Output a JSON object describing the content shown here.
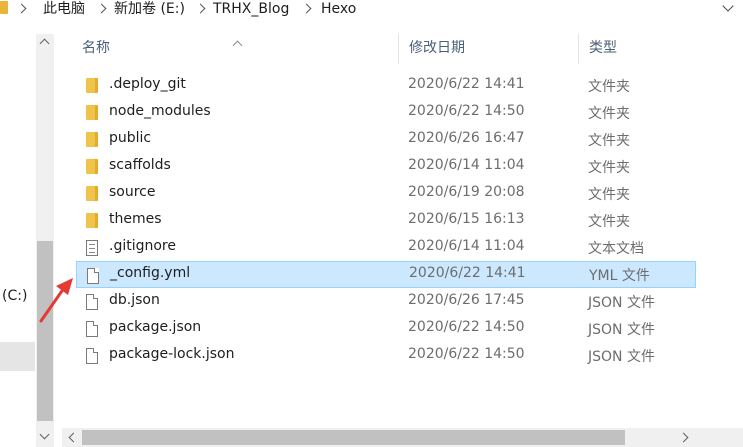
{
  "breadcrumb": {
    "items": [
      "此电脑",
      "新加卷 (E:)",
      "TRHX_Blog",
      "Hexo"
    ]
  },
  "nav": {
    "drive_label": "(C:)"
  },
  "columns": {
    "name": "名称",
    "date": "修改日期",
    "type": "类型"
  },
  "files": [
    {
      "name": ".deploy_git",
      "date": "2020/6/22 14:41",
      "type": "文件夹",
      "icon": "folder-icon"
    },
    {
      "name": "node_modules",
      "date": "2020/6/22 14:50",
      "type": "文件夹",
      "icon": "folder-icon"
    },
    {
      "name": "public",
      "date": "2020/6/26 16:47",
      "type": "文件夹",
      "icon": "folder-icon"
    },
    {
      "name": "scaffolds",
      "date": "2020/6/14 11:04",
      "type": "文件夹",
      "icon": "folder-icon"
    },
    {
      "name": "source",
      "date": "2020/6/19 20:08",
      "type": "文件夹",
      "icon": "folder-icon"
    },
    {
      "name": "themes",
      "date": "2020/6/15 16:13",
      "type": "文件夹",
      "icon": "folder-icon"
    },
    {
      "name": ".gitignore",
      "date": "2020/6/14 11:04",
      "type": "文本文档",
      "icon": "text-file-icon"
    },
    {
      "name": "_config.yml",
      "date": "2020/6/22 14:41",
      "type": "YML 文件",
      "icon": "file-icon"
    },
    {
      "name": "db.json",
      "date": "2020/6/26 17:45",
      "type": "JSON 文件",
      "icon": "file-icon"
    },
    {
      "name": "package.json",
      "date": "2020/6/22 14:50",
      "type": "JSON 文件",
      "icon": "file-icon"
    },
    {
      "name": "package-lock.json",
      "date": "2020/6/22 14:50",
      "type": "JSON 文件",
      "icon": "file-icon"
    }
  ],
  "selected_file": "_config.yml",
  "colors": {
    "selection_bg": "#cce8ff",
    "selection_border": "#99d1ff",
    "folder": "#f0c34a",
    "annotation_arrow": "#e53935",
    "header_text": "#4c607a"
  }
}
